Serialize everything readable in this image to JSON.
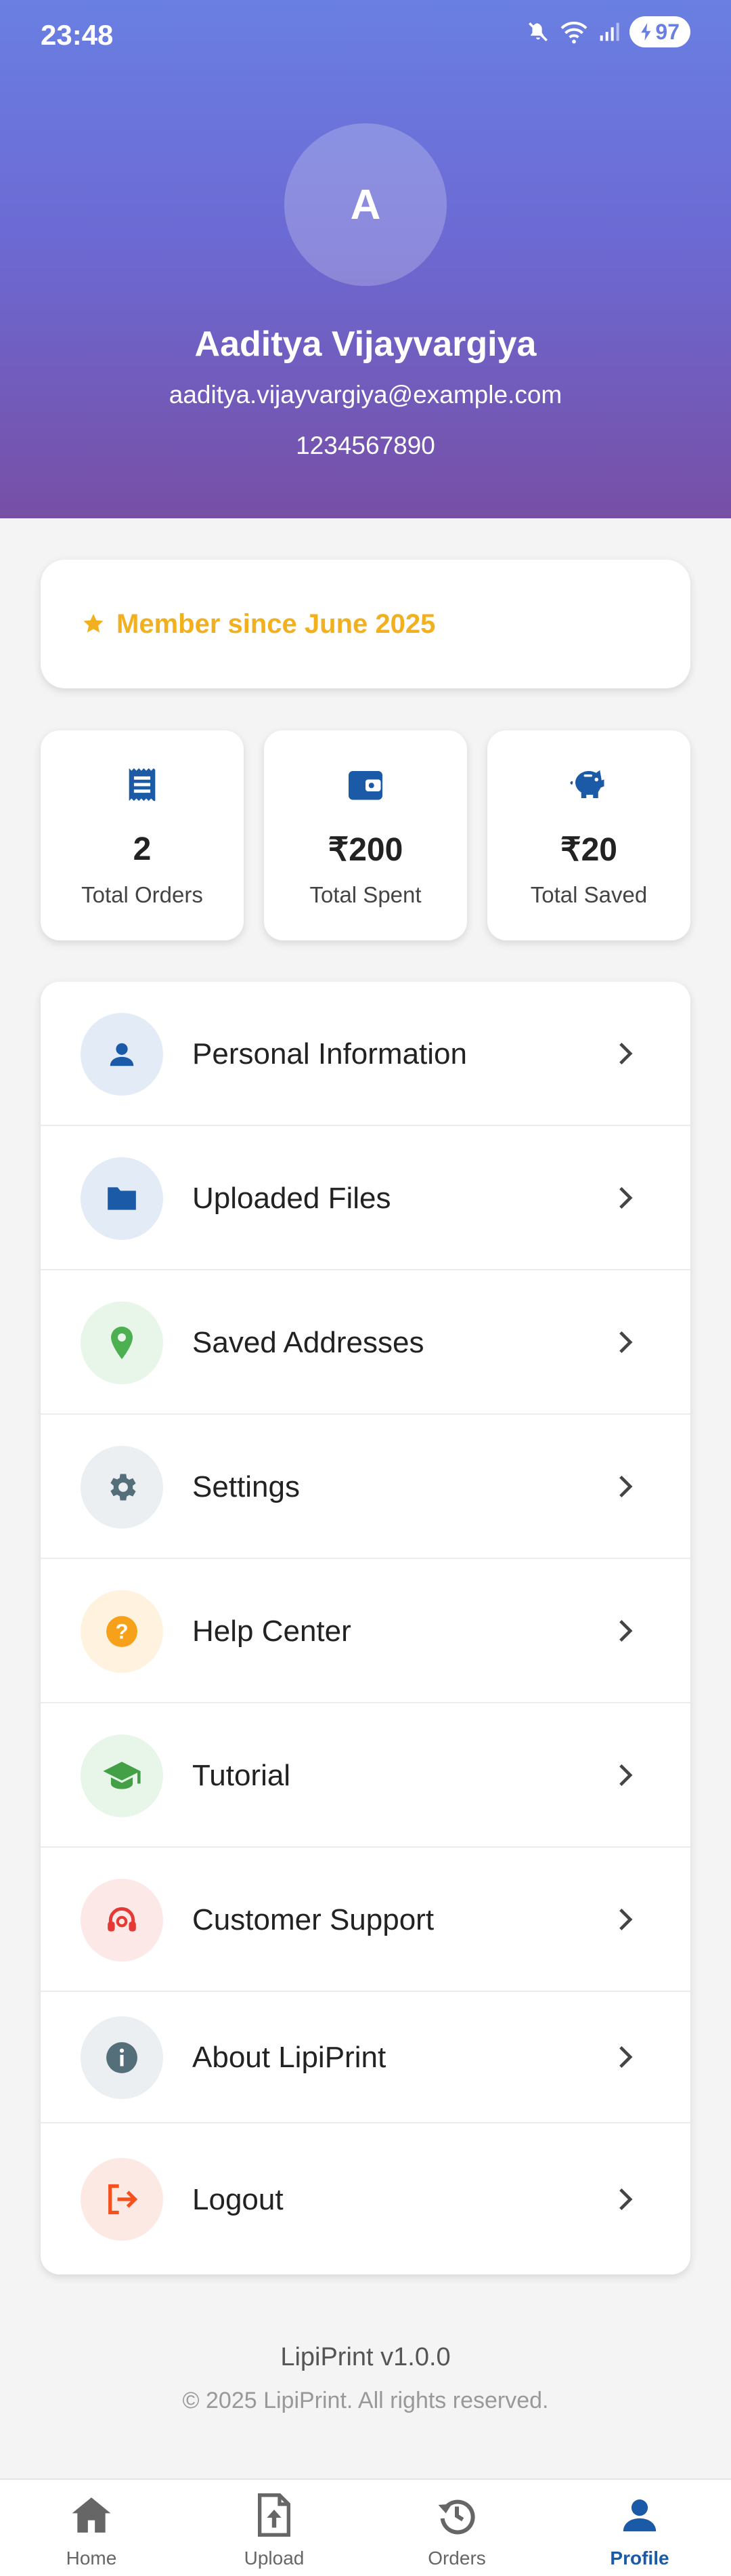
{
  "status_bar": {
    "time": "23:48",
    "battery": "97"
  },
  "profile": {
    "avatar_initial": "A",
    "name": "Aaditya Vijayvargiya",
    "email": "aaditya.vijayvargiya@example.com",
    "phone": "1234567890"
  },
  "membership": {
    "text": "Member since June 2025",
    "icon": "star-icon",
    "color": "#f2b01e"
  },
  "stats": [
    {
      "value": "2",
      "label": "Total Orders",
      "icon": "receipt-icon"
    },
    {
      "value": "₹200",
      "label": "Total Spent",
      "icon": "wallet-icon"
    },
    {
      "value": "₹20",
      "label": "Total Saved",
      "icon": "piggy-bank-icon"
    }
  ],
  "menu": [
    {
      "label": "Personal Information",
      "icon": "person-icon",
      "color": "#1a5aa6",
      "bg": "#e3ecf6"
    },
    {
      "label": "Uploaded Files",
      "icon": "folder-icon",
      "color": "#1a5aa6",
      "bg": "#e3ecf6"
    },
    {
      "label": "Saved Addresses",
      "icon": "location-pin-icon",
      "color": "#4caf50",
      "bg": "#e8f5e9"
    },
    {
      "label": "Settings",
      "icon": "gear-icon",
      "color": "#546e7a",
      "bg": "#eceff1"
    },
    {
      "label": "Help Center",
      "icon": "help-icon",
      "color": "#f7a11a",
      "bg": "#fff3e0"
    },
    {
      "label": "Tutorial",
      "icon": "graduation-cap-icon",
      "color": "#43a047",
      "bg": "#e8f5e9"
    },
    {
      "label": "Customer Support",
      "icon": "headset-icon",
      "color": "#e53935",
      "bg": "#fde8e8"
    },
    {
      "label": "About LipiPrint",
      "icon": "info-icon",
      "color": "#546e7a",
      "bg": "#eceff1"
    },
    {
      "label": "Logout",
      "icon": "logout-icon",
      "color": "#f4511e",
      "bg": "#fde9e4"
    }
  ],
  "footer": {
    "version": "LipiPrint v1.0.0",
    "copyright": "© 2025 LipiPrint. All rights reserved."
  },
  "bottom_nav": [
    {
      "label": "Home",
      "icon": "home-icon",
      "active": false
    },
    {
      "label": "Upload",
      "icon": "upload-file-icon",
      "active": false
    },
    {
      "label": "Orders",
      "icon": "history-icon",
      "active": false
    },
    {
      "label": "Profile",
      "icon": "person-icon",
      "active": true
    }
  ],
  "colors": {
    "accent": "#1a5aa6",
    "header_top": "#6a7fe2",
    "header_bottom": "#774fa6"
  }
}
